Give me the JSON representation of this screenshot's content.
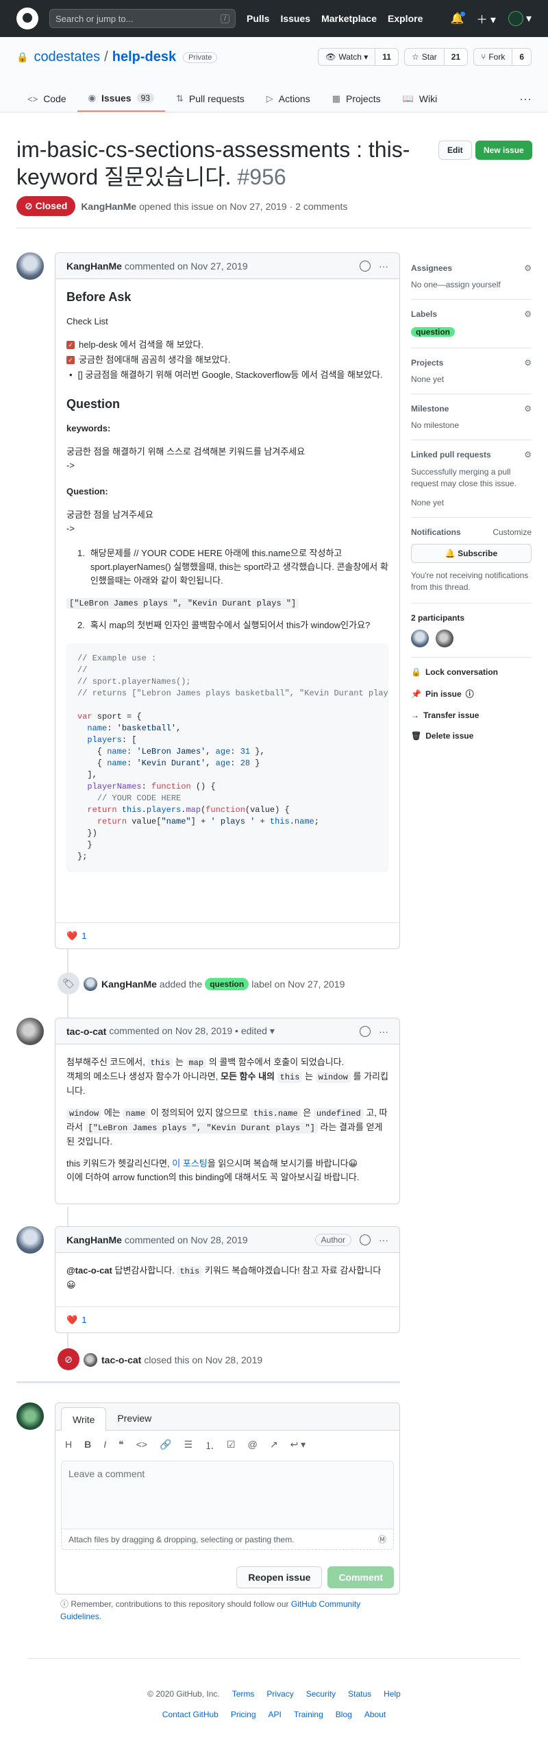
{
  "header": {
    "search_placeholder": "Search or jump to...",
    "slash": "/",
    "nav": [
      "Pulls",
      "Issues",
      "Marketplace",
      "Explore"
    ]
  },
  "repo": {
    "owner": "codestates",
    "sep": "/",
    "name": "help-desk",
    "visibility": "Private",
    "watch_label": "Watch",
    "watch_count": "11",
    "star_label": "Star",
    "star_count": "21",
    "fork_label": "Fork",
    "fork_count": "6"
  },
  "tabs": [
    {
      "label": "Code",
      "icon": "code-icon"
    },
    {
      "label": "Issues",
      "icon": "issue-icon",
      "count": "93"
    },
    {
      "label": "Pull requests",
      "icon": "pr-icon"
    },
    {
      "label": "Actions",
      "icon": "play-icon"
    },
    {
      "label": "Projects",
      "icon": "project-icon"
    },
    {
      "label": "Wiki",
      "icon": "book-icon"
    }
  ],
  "issue": {
    "title": "im-basic-cs-sections-assessments : this-keyword 질문있습니다.",
    "number": "#956",
    "edit_label": "Edit",
    "new_label": "New issue",
    "state": "Closed",
    "author": "KangHanMe",
    "opened_text": "opened this issue on Nov 27, 2019 · 2 comments"
  },
  "comment1": {
    "author": "KangHanMe",
    "meta": "commented on Nov 27, 2019",
    "h_before": "Before Ask",
    "h_check": "Check List",
    "checks": [
      "help-desk 에서 검색을 해 보았다.",
      "궁금한 점에대해 곰곰히 생각을 해보았다."
    ],
    "bullet": "[] 궁금점을 해결하기 위해 여러번 Google, Stackoverflow등 에서 검색을 해보았다.",
    "h_question": "Question",
    "keywords_label": "keywords:",
    "keywords_desc": "궁금한 점을 해결하기 위해 스스로 검색해본 키워드를 남겨주세요",
    "arrow1": "->",
    "question_label": "Question:",
    "question_desc": "궁금한 점을 남겨주세요",
    "arrow2": "->",
    "ol1": "해당문제를 // YOUR CODE HERE 아래에 this.name으로 작성하고 sport.playerNames() 실행했을때, this는 sport라고 생각했습니다. 콘솔창에서 확인했을때는 아래와 같이 확인됩니다.",
    "inline_result": "[\"LeBron James plays \", \"Kevin Durant plays \"]",
    "ol2": "혹시 map의 첫번째 인자인 콜백함수에서 실행되어서 this가 window인가요?",
    "reaction_count": "1"
  },
  "event_label": {
    "user": "KangHanMe",
    "text_before": "added the",
    "label": "question",
    "text_after": "label on Nov 27, 2019"
  },
  "comment2": {
    "author": "tac-o-cat",
    "meta": "commented on Nov 28, 2019 • edited ▾",
    "p1a": "첨부해주신 코드에서,",
    "p1_this": "this",
    "p1b": "는",
    "p1_map": "map",
    "p1c": "의 콜백 함수에서 호출이 되었습니다.",
    "p1d": "객체의 메소드나 생성자 함수가 아니라면,",
    "p1_bold": "모든 함수 내의",
    "p1_this2": "this",
    "p1e": "는",
    "p1_window": "window",
    "p1f": "를 가리킵니다.",
    "p2_window": "window",
    "p2a": "에는",
    "p2_name": "name",
    "p2b": "이 정의되어 있지 않으므로",
    "p2_thisname": "this.name",
    "p2c": "은",
    "p2_undef": "undefined",
    "p2d": "고, 따라서",
    "p2_result": "[\"LeBron James plays \", \"Kevin Durant plays \"]",
    "p2e": "라는 결과를 얻게 된 것입니다.",
    "p3a": "this 키워드가 헷갈리신다면,",
    "p3_link": "이 포스팅",
    "p3b": "을 읽으시며 복습해 보시기를 바랍니다😀",
    "p4": "이에 더하여 arrow function의 this binding에 대해서도 꼭 알아보시길 바랍니다."
  },
  "comment3": {
    "author": "KangHanMe",
    "meta": "commented on Nov 28, 2019",
    "badge": "Author",
    "mention": "@tac-o-cat",
    "text_a": "답변감사합니다.",
    "code": "this",
    "text_b": "키워드 복습해야겠습니다! 참고 자료 감사합니다 😀",
    "reaction_count": "1"
  },
  "event_closed": {
    "user": "tac-o-cat",
    "text": "closed this on Nov 28, 2019"
  },
  "sidebar": {
    "assignees": "Assignees",
    "assignees_val": "No one—assign yourself",
    "labels": "Labels",
    "label_val": "question",
    "projects": "Projects",
    "projects_val": "None yet",
    "milestone": "Milestone",
    "milestone_val": "No milestone",
    "linked": "Linked pull requests",
    "linked_desc": "Successfully merging a pull request may close this issue.",
    "linked_val": "None yet",
    "notifications": "Notifications",
    "customize": "Customize",
    "subscribe": "Subscribe",
    "notif_desc": "You're not receiving notifications from this thread.",
    "participants": "2 participants",
    "lock": "Lock conversation",
    "pin": "Pin issue",
    "transfer": "Transfer issue",
    "delete": "Delete issue"
  },
  "reply": {
    "tab_write": "Write",
    "tab_preview": "Preview",
    "placeholder": "Leave a comment",
    "attach": "Attach files by dragging & dropping, selecting or pasting them.",
    "reopen": "Reopen issue",
    "comment": "Comment",
    "remember_a": "Remember, contributions to this repository should follow our",
    "remember_link": "GitHub Community Guidelines."
  },
  "footer": {
    "copy": "© 2020 GitHub, Inc.",
    "row1": [
      "Terms",
      "Privacy",
      "Security",
      "Status",
      "Help"
    ],
    "row2": [
      "Contact GitHub",
      "Pricing",
      "API",
      "Training",
      "Blog",
      "About"
    ]
  },
  "colors": {
    "accent": "#0366d6",
    "closed": "#cb2431",
    "green": "#2ea44f",
    "label": "#5be68b"
  }
}
